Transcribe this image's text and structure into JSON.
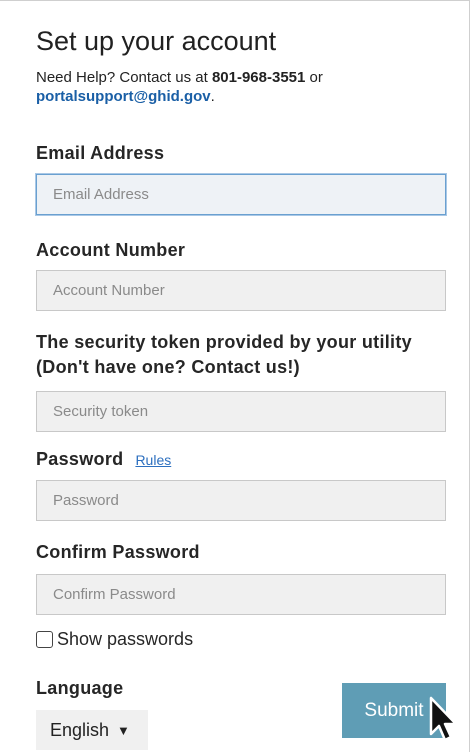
{
  "page": {
    "title": "Set up your account",
    "help_prefix": "Need Help? Contact us at ",
    "help_phone": "801-968-3551",
    "help_or": " or",
    "help_email": "portalsupport@ghid.gov",
    "help_suffix": "."
  },
  "form": {
    "email": {
      "label": "Email Address",
      "placeholder": "Email Address",
      "value": ""
    },
    "account": {
      "label": "Account Number",
      "placeholder": "Account Number",
      "value": ""
    },
    "token": {
      "label": "The security token provided by your utility (Don't have one? Contact us!)",
      "placeholder": "Security token",
      "value": ""
    },
    "password": {
      "label": "Password",
      "rules_link": "Rules",
      "placeholder": "Password",
      "value": ""
    },
    "confirm": {
      "label": "Confirm Password",
      "placeholder": "Confirm Password",
      "value": ""
    },
    "show_passwords": {
      "label": "Show passwords",
      "checked": false
    },
    "language": {
      "label": "Language",
      "selected": "English",
      "caret": "▼"
    },
    "submit_label": "Submit"
  },
  "colors": {
    "link": "#1a5fa6",
    "button": "#5f9db5",
    "field_bg": "#f0f0f0",
    "focus_border": "#6aa0d0"
  },
  "icons": {
    "cursor": "arrow-cursor-icon",
    "select_caret": "caret-down-icon"
  }
}
